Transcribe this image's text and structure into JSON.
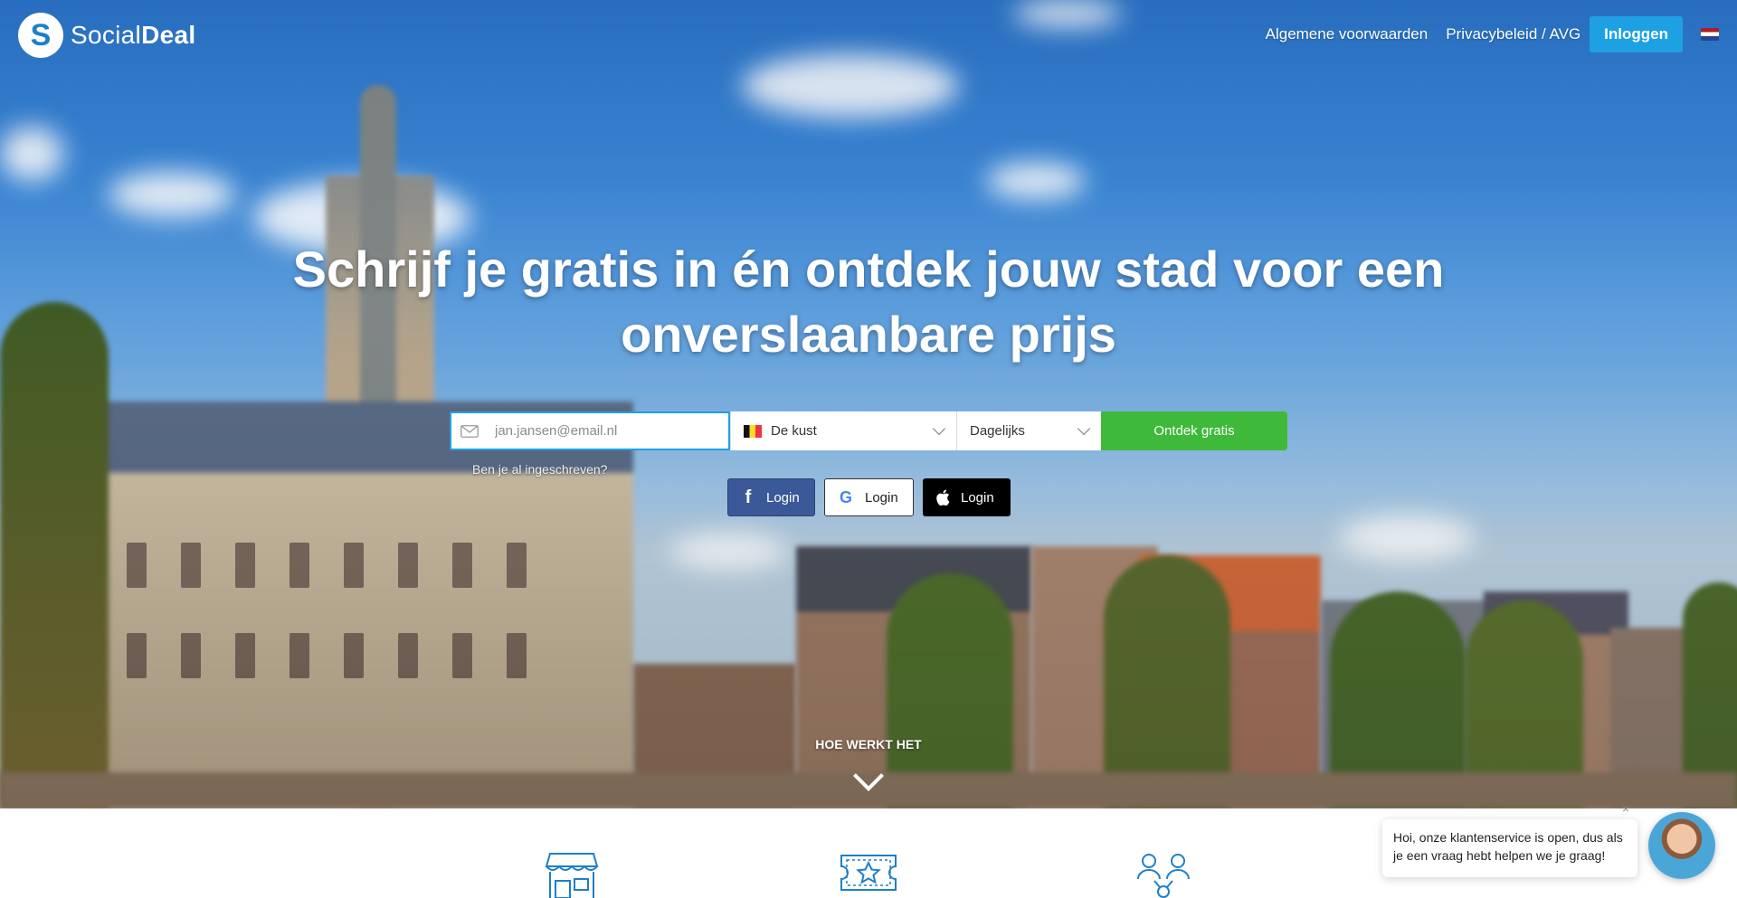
{
  "brand": {
    "name_light": "Social",
    "name_bold": "Deal",
    "mark": "S"
  },
  "nav": {
    "links": [
      "Algemene voorwaarden",
      "Privacybeleid / AVG"
    ],
    "login_label": "Inloggen",
    "language_flag": "nl-flag-icon"
  },
  "hero": {
    "headline": "Schrijf je gratis in én ontdek jouw stad voor een onverslaanbare prijs"
  },
  "signup": {
    "email_placeholder": "jan.jansen@email.nl",
    "city_value": "De kust",
    "city_flag": "be-flag-icon",
    "frequency_value": "Dagelijks",
    "submit_label": "Ontdek gratis",
    "already_subscribed": "Ben je al ingeschreven?"
  },
  "social_login": [
    {
      "provider": "facebook",
      "label": "Login",
      "icon": "facebook-icon"
    },
    {
      "provider": "google",
      "label": "Login",
      "icon": "google-icon"
    },
    {
      "provider": "apple",
      "label": "Login",
      "icon": "apple-icon"
    }
  ],
  "how_it_works": {
    "label": "HOE WERKT HET"
  },
  "features_icons": [
    "shop-icon",
    "ticket-star-icon",
    "people-network-icon"
  ],
  "chat": {
    "message": "Hoi, onze klantenservice is open, dus als je een vraag hebt helpen we je graag!",
    "close": "×"
  },
  "colors": {
    "primary_blue": "#1ea1e3",
    "cta_green": "#3fb93a",
    "facebook": "#3b5998"
  }
}
